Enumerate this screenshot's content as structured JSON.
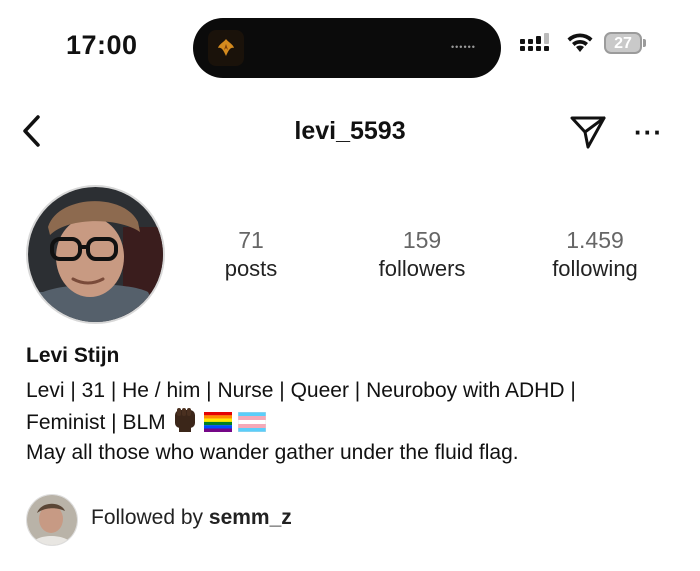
{
  "status_bar": {
    "time": "17:00",
    "battery_level": "27",
    "icons": [
      "signal-icon",
      "wifi-icon",
      "battery-icon"
    ]
  },
  "header": {
    "username": "levi_5593",
    "icons": [
      "back-chevron-icon",
      "send-icon",
      "more-icon"
    ]
  },
  "stats": [
    {
      "count": "71",
      "label": "posts"
    },
    {
      "count": "159",
      "label": "followers"
    },
    {
      "count": "1.459",
      "label": "following"
    }
  ],
  "bio": {
    "name": "Levi Stijn",
    "line1": "Levi | 31 | He / him | Nurse | Queer | Neuroboy with ADHD |",
    "line2": "Feminist | BLM",
    "line3": "May all those who wander gather under the fluid flag.",
    "emojis": [
      "raised-fist-emoji",
      "rainbow-flag-emoji",
      "transgender-flag-emoji"
    ]
  },
  "followed_by": {
    "prefix": "Followed by",
    "user": "semm_z"
  },
  "colors": {
    "text": "#111111",
    "muted_count": "#666666",
    "island": "#0b0b0b",
    "battery": "#c9c9c9"
  }
}
